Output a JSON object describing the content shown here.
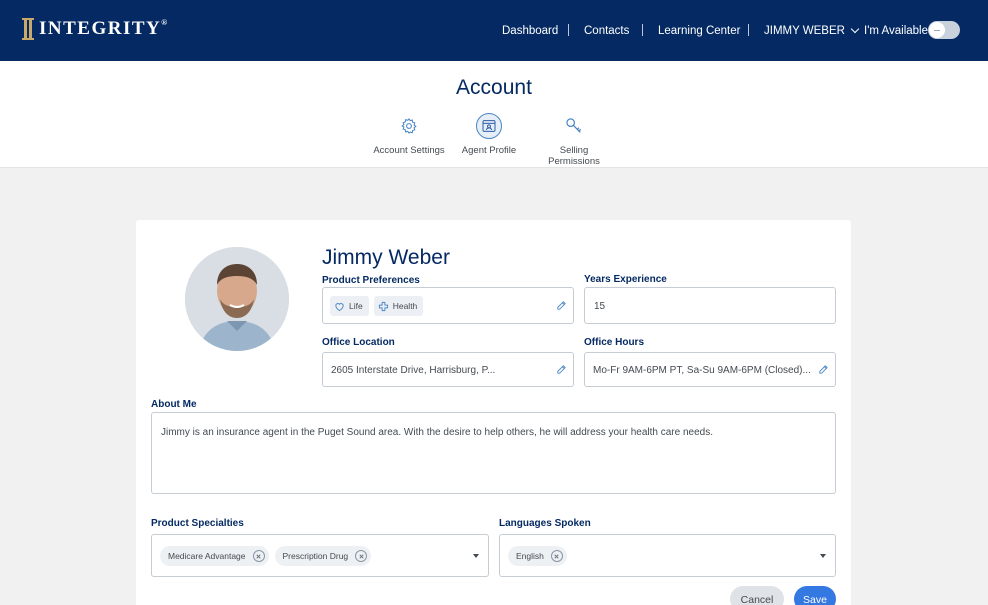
{
  "brand": {
    "name": "INTEGRITY",
    "mark": "®"
  },
  "nav": {
    "dashboard": "Dashboard",
    "contacts": "Contacts",
    "learning_center": "Learning Center",
    "user": "JIMMY WEBER",
    "availability": "I'm Available",
    "availability_on": false
  },
  "page": {
    "title": "Account",
    "tabs": [
      {
        "label": "Account Settings",
        "icon": "gear-icon"
      },
      {
        "label": "Agent Profile",
        "icon": "profile-card-icon",
        "active": true
      },
      {
        "label": "Selling Permissions",
        "icon": "key-icon"
      }
    ]
  },
  "profile": {
    "name": "Jimmy Weber",
    "product_preferences_label": "Product Preferences",
    "product_preferences": [
      "Life",
      "Health"
    ],
    "years_experience_label": "Years Experience",
    "years_experience": "15",
    "office_location_label": "Office Location",
    "office_location": "2605 Interstate Drive, Harrisburg, P...",
    "office_hours_label": "Office Hours",
    "office_hours": "Mo-Fr 9AM-6PM PT, Sa-Su 9AM-6PM (Closed)...",
    "about_label": "About Me",
    "about": "Jimmy is an insurance agent in the Puget Sound area. With the desire to help others, he will address your health care needs.",
    "specialties_label": "Product Specialties",
    "specialties": [
      "Medicare Advantage",
      "Prescription Drug"
    ],
    "languages_label": "Languages Spoken",
    "languages": [
      "English"
    ]
  },
  "actions": {
    "cancel": "Cancel",
    "save": "Save"
  },
  "colors": {
    "nav_bg": "#052a63",
    "accent": "#3478e2",
    "brand_gold": "#c9a96a"
  }
}
